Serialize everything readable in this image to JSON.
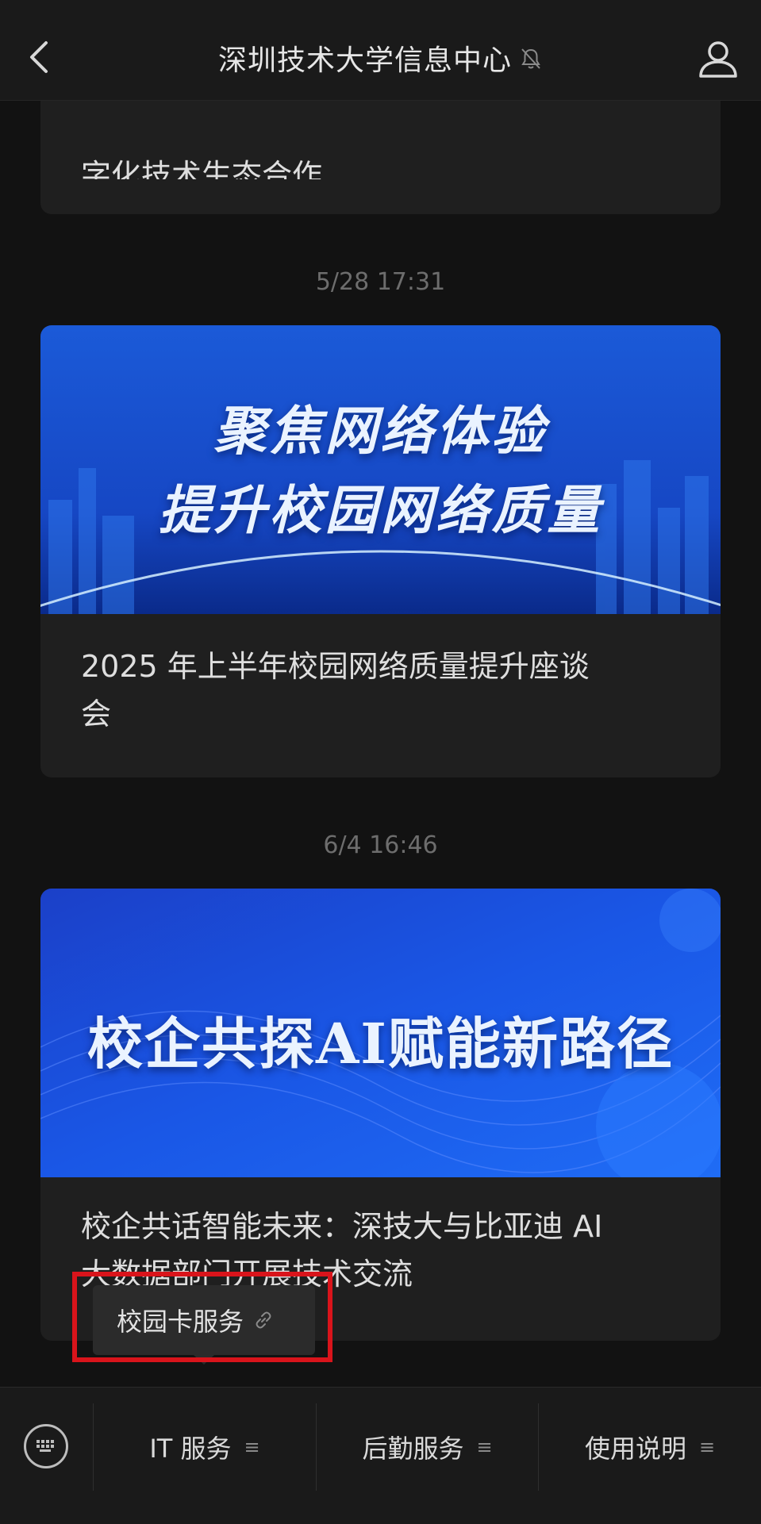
{
  "header": {
    "title": "深圳技术大学信息中心",
    "back_icon": "chevron-left-icon",
    "mute_icon": "bell-muted-icon",
    "profile_icon": "person-icon"
  },
  "messages": [
    {
      "title": "深圳技术大学与深圳市 CIO 协会共商数字化技术生态合作",
      "title_visible_line": "字化技术生态合作"
    },
    {
      "timestamp": "5/28 17:31",
      "banner_line1": "聚焦网络体验",
      "banner_line2": "提升校园网络质量",
      "title_line1": "2025 年上半年校园网络质量提升座谈",
      "title_line2": "会"
    },
    {
      "timestamp": "6/4 16:46",
      "banner_text": "校企共探AI赋能新路径",
      "title_line1": "校企共话智能未来：深技大与比亚迪 AI",
      "title_line2": "大数据部门开展技术交流"
    }
  ],
  "tooltip": {
    "label": "校园卡服务",
    "icon": "link-icon"
  },
  "bottom_menu": {
    "keyboard_icon": "keyboard-icon",
    "items": [
      {
        "label": "IT 服务",
        "icon": "menu-lines-icon"
      },
      {
        "label": "后勤服务",
        "icon": "menu-lines-icon"
      },
      {
        "label": "使用说明",
        "icon": "menu-lines-icon"
      }
    ]
  },
  "colors": {
    "background": "#121212",
    "card": "#1f1f1f",
    "highlight": "#d9141b",
    "banner_blue": "#1a5fe0"
  }
}
